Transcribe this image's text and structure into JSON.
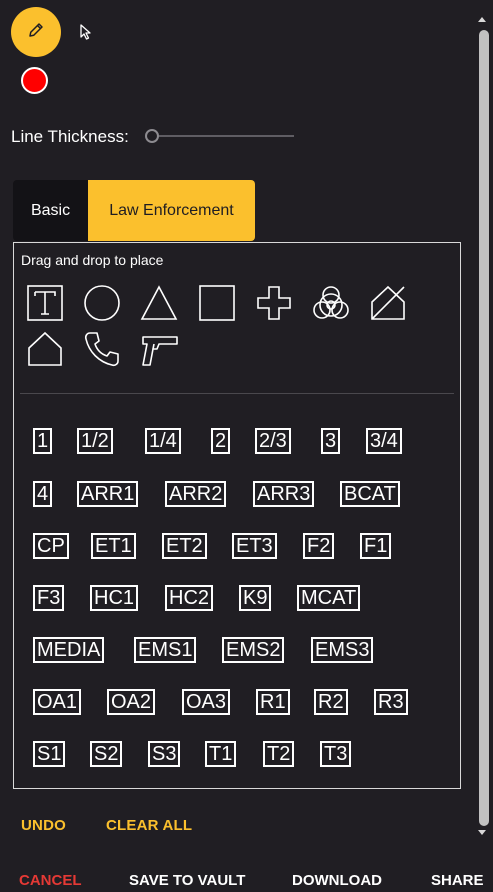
{
  "toolbar": {
    "pencil_icon": "pencil-icon",
    "cursor_icon": "cursor-arrow-icon",
    "current_color": "#ff0000",
    "accent": "#fbc02d"
  },
  "thickness": {
    "label": "Line Thickness:",
    "value": 0
  },
  "tabs": [
    {
      "label": "Basic",
      "active": false
    },
    {
      "label": "Law Enforcement",
      "active": true
    }
  ],
  "panel": {
    "hint": "Drag and drop to place",
    "icons": [
      "text-tool-icon",
      "circle-icon",
      "triangle-icon",
      "square-icon",
      "cross-icon",
      "biohazard-icon",
      "house-crossed-icon",
      "house-icon",
      "phone-icon",
      "gun-icon"
    ],
    "labels": [
      [
        "1",
        "1/2",
        "1/4",
        "2",
        "2/3",
        "3",
        "3/4"
      ],
      [
        "4",
        "ARR1",
        "ARR2",
        "ARR3",
        "BCAT"
      ],
      [
        "CP",
        "ET1",
        "ET2",
        "ET3",
        "F2",
        "F1"
      ],
      [
        "F3",
        "HC1",
        "HC2",
        "K9",
        "MCAT"
      ],
      [
        "MEDIA",
        "EMS1",
        "EMS2",
        "EMS3"
      ],
      [
        "OA1",
        "OA2",
        "OA3",
        "R1",
        "R2",
        "R3"
      ],
      [
        "S1",
        "S2",
        "S3",
        "T1",
        "T2",
        "T3"
      ]
    ]
  },
  "actions": {
    "undo": "UNDO",
    "clear_all": "CLEAR ALL"
  },
  "footer": {
    "cancel": "CANCEL",
    "save": "SAVE TO VAULT",
    "download": "DOWNLOAD",
    "share": "SHARE",
    "cancel_color": "#e53935"
  }
}
